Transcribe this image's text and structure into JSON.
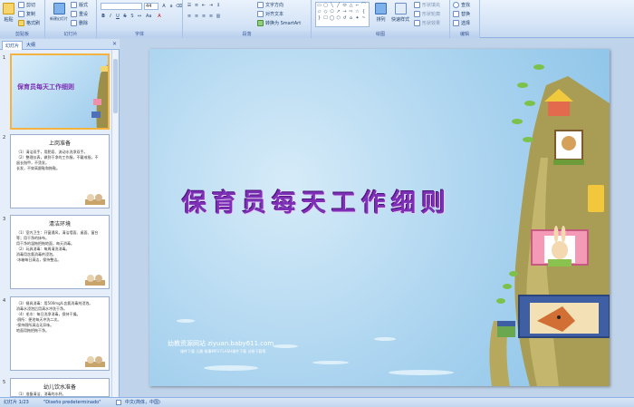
{
  "ribbon": {
    "clipboard": {
      "paste": "粘贴",
      "cut": "剪切",
      "copy": "复制",
      "format_painter": "格式刷",
      "label": "剪贴板"
    },
    "slides": {
      "new_slide": "新建幻灯片",
      "layout": "版式",
      "reset": "重设",
      "delete": "删除",
      "label": "幻灯片"
    },
    "font": {
      "font_name": "",
      "font_size": "44",
      "label": "字体"
    },
    "paragraph": {
      "text_direction": "文字方向",
      "align_text": "对齐文本",
      "smartart": "转换为 SmartArt",
      "label": "段落"
    },
    "drawing": {
      "arrange": "排列",
      "quick_styles": "快速样式",
      "shape_fill": "形状填充",
      "shape_outline": "形状轮廓",
      "shape_effects": "形状效果",
      "label": "绘图"
    },
    "editing": {
      "find": "查找",
      "replace": "替换",
      "select": "选择",
      "label": "编辑"
    }
  },
  "pane": {
    "tabs": [
      "幻灯片",
      "大纲"
    ],
    "slides": [
      {
        "num": "1",
        "title": "保育员每天工作细则",
        "bullets": []
      },
      {
        "num": "2",
        "title": "上岗准备",
        "bullets": [
          "（1）清洁双手，用肥皂、流动水洗净双手。",
          "（2）整理仪表，做到干净的工作服，不戴戒指，不留长指甲，不烫发。",
          "长发，不穿高跟鞋和拖鞋。"
        ]
      },
      {
        "num": "3",
        "title": "清洁环境",
        "bullets": [
          "（1）室内卫生：开窗通风，清洁墙面、桌面、窗台等；用干净的抹布。",
          "用干净的湿拖把拖地面，每天消毒。",
          "（2）玩具消毒：每周清洗消毒。",
          "消毒用含氯消毒剂浸泡。",
          "·冰箱每日清洁，保持整洁。"
        ]
      },
      {
        "num": "4",
        "title": "",
        "bullets": [
          "（3）餐具消毒：用500mg/L含氯消毒剂浸泡。",
          "消毒水浸泡后用清水冲洗干净。",
          "（4）毛巾：每日洗净消毒，保持干燥。",
          "·厕所：便池每天冲洗二次。",
          "·保持厕所清洁无异味。",
          "地面用拖把拖干净。"
        ]
      },
      {
        "num": "5",
        "title": "幼儿饮水准备",
        "bullets": [
          "（1）准备清洁、消毒的水杯。"
        ]
      }
    ]
  },
  "slide": {
    "title": "保育员每天工作细则",
    "footer_site": "幼教资源网站  ziyuan.baby611.com",
    "footer_sub": "课件下载  儿歌  故事MP3  FLASH课件下载  试卷下载等"
  },
  "status": {
    "slide_counter": "幻灯片 1/23",
    "theme": "\"Diseño predeterminado\"",
    "language": "中文(简体，中国)"
  },
  "colors": {
    "title": "#7d2fb5",
    "accent": "#f4b23f"
  },
  "icons": [
    "paste-icon",
    "cut-icon",
    "copy-icon",
    "format-painter-icon",
    "new-slide-icon",
    "find-icon",
    "replace-icon",
    "select-icon",
    "arrange-icon",
    "quick-styles-icon",
    "close-pane-icon"
  ]
}
